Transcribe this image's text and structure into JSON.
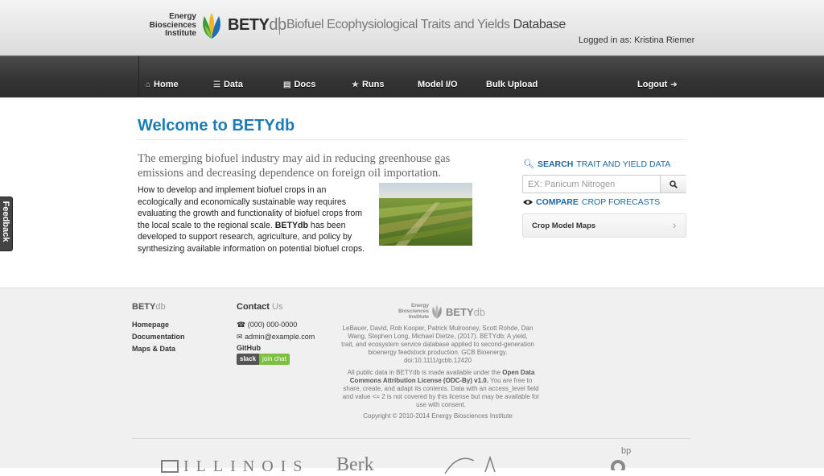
{
  "header": {
    "org_name_lines": [
      "Energy",
      "Biosciences",
      "Institute"
    ],
    "brand_main": "BETY",
    "brand_suffix": "db",
    "subtitle": "Biofuel Ecophysiological Traits and Yields",
    "subtitle_bold": "Database",
    "login_status": "Logged in as: Kristina Riemer"
  },
  "nav": {
    "items": [
      {
        "label": "Home",
        "icon": "home-icon"
      },
      {
        "label": "Data",
        "icon": "list-icon"
      },
      {
        "label": "Docs",
        "icon": "docs-icon"
      },
      {
        "label": "Runs",
        "icon": "star-icon"
      },
      {
        "label": "Model I/O",
        "icon": ""
      },
      {
        "label": "Bulk Upload",
        "icon": ""
      }
    ],
    "logout_label": "Logout",
    "logout_icon": "arrow-right-icon"
  },
  "main": {
    "title": "Welcome to BETYdb",
    "lead": "The emerging biofuel industry may aid in reducing greenhouse gas emissions and decreasing dependence on foreign oil importation.",
    "body_before": "How to develop and implement biofuel crops in an ecologically and economically sustainable way requires evaluating the growth and functionality of biofuel crops from the local scale to the regional scale. ",
    "body_bold": "BETYdb",
    "body_after": " has been developed to support research, agriculture, and policy by synthesizing available information on potential biofuel crops."
  },
  "sidebar": {
    "search_bold": "SEARCH",
    "search_rest": "TRAIT AND YIELD DATA",
    "search_placeholder": "EX: Panicum Nitrogen",
    "compare_bold": "COMPARE",
    "compare_rest": "CROP FORECASTS",
    "map_panel_label": "Crop Model Maps"
  },
  "feedback": {
    "label": "Feedback"
  },
  "footer": {
    "brand_main": "BETY",
    "brand_suffix": "db",
    "links": [
      "Homepage",
      "Documentation",
      "Maps & Data"
    ],
    "contact_title": "Contact",
    "contact_title_light": "Us",
    "phone": "(000) 000-0000",
    "email": "admin@example.com",
    "github": "GitHub",
    "slack_left": "slack",
    "slack_right": "join chat",
    "logo_org_lines": [
      "Energy",
      "Biosciences",
      "Institute"
    ],
    "logo_brand_main": "BETY",
    "logo_brand_suffix": "db",
    "citation": "LeBauer, David, Rob Kooper, Patrick Mulrooney, Scott Rohde, Dan Wang, Stephen Long, Michael Dietze, (2017). BETYdb: A yield, trait, and ecosystem service database applied to second-generation bioenergy feedstock production. GCB Bioenergy. doi:10.1111/gcbb.12420",
    "license_before": "All public data in BETYdb is made available under the ",
    "license_bold": "Open Data Commons Attribution License (ODC-By) v1.0.",
    "license_after": " You are free to share, create, and adapt its contents. Data with an access_level field and value <= 2 is not covered by this license but may be available for use with consent.",
    "copyright": "Copyright © 2010-2014 Energy Biosciences Institute",
    "partners": {
      "illinois": "ILLINOIS",
      "berkeley": "Berk",
      "bp": "bp"
    }
  },
  "colors": {
    "accent": "#1c7cb6",
    "nav_bg": "#333333",
    "slack_green": "#7ac142"
  }
}
